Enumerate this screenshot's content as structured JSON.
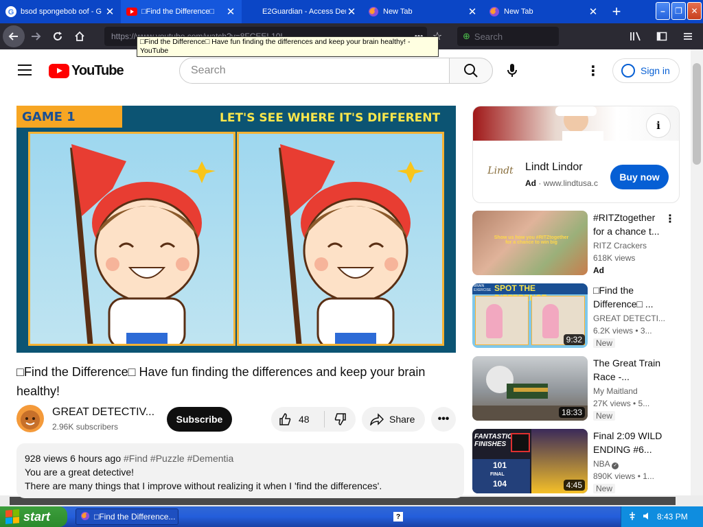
{
  "browser": {
    "tabs": [
      {
        "title": "bsod spongebob oof - G",
        "favicon": "google-icon",
        "active": false
      },
      {
        "title": "□Find the Difference□",
        "favicon": "youtube-icon",
        "active": true
      },
      {
        "title": "E2Guardian - Access Denied",
        "favicon": "none",
        "active": false
      },
      {
        "title": "New Tab",
        "favicon": "firefox-icon",
        "active": false
      },
      {
        "title": "New Tab",
        "favicon": "firefox-icon",
        "active": false
      }
    ],
    "url_partial": "https://www.youtube.com/watch?v=8FCEEL10L",
    "search_placeholder": "Search",
    "tooltip": "□Find the Difference□ Have fun finding the differences and keep your brain healthy! - YouTube"
  },
  "youtube": {
    "logo_text": "YouTube",
    "search_placeholder": "Search",
    "signin_label": "Sign in"
  },
  "video": {
    "game_label": "GAME 1",
    "game_heading": "LET'S SEE WHERE IT'S DIFFERENT",
    "title": "□Find the Difference□ Have fun finding the differences and keep your brain healthy!",
    "channel_name": "GREAT DETECTIV...",
    "subscribers": "2.96K subscribers",
    "subscribe_label": "Subscribe",
    "likes": "48",
    "share_label": "Share",
    "views": "928 views",
    "posted": "6 hours ago",
    "hashtags": "#Find #Puzzle #Dementia",
    "description_line1": "You are a great detective!",
    "description_line2": "There are many things that I improve without realizing it when I 'find the differences'."
  },
  "ad": {
    "title": "Lindt Lindor",
    "label": "Ad",
    "domain": "www.lindtusa.c",
    "cta": "Buy now",
    "logo_text": "Lindt"
  },
  "recommendations": [
    {
      "title": "#RITZtogether for a chance t...",
      "channel": "RITZ Crackers",
      "views": "618K views",
      "badge": "Ad",
      "is_ad": true,
      "duration": "",
      "thumb_caption": "Show us how you #RITZtogether for a chance to win big"
    },
    {
      "title": "□Find the Difference□ ...",
      "channel": "GREAT DETECTI...",
      "views": "6.2K views • 3...",
      "badge": "New",
      "is_ad": false,
      "duration": "9:32",
      "thumb_caption": "SPOT THE DIFFERENCE",
      "thumb_caption2": "BRAIN EXERCISE"
    },
    {
      "title": "The Great Train Race -...",
      "channel": "My Maitland",
      "views": "27K views • 5...",
      "badge": "New",
      "is_ad": false,
      "duration": "18:33",
      "thumb_caption": ""
    },
    {
      "title": "Final 2:09 WILD ENDING #6...",
      "channel": "NBA",
      "views": "890K views • 1...",
      "badge": "New",
      "is_ad": false,
      "duration": "4:45",
      "thumb_caption": "FANTASTIC FINISHES",
      "thumb_score1": "101",
      "thumb_score2": "104",
      "thumb_final": "FINAL"
    }
  ],
  "taskbar": {
    "start_label": "start",
    "task_title": "□Find the Difference...",
    "clock": "8:43 PM"
  }
}
